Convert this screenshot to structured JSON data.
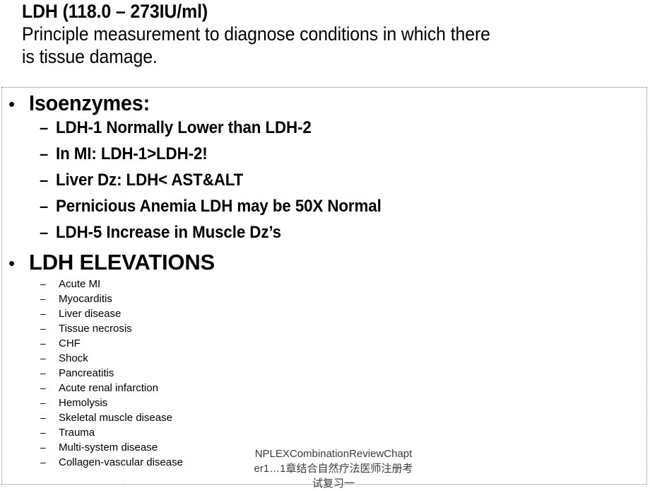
{
  "slide": {
    "title": {
      "heading": "LDH (118.0 – 273IU/ml)",
      "subline_1": "Principle measurement to diagnose conditions in which there",
      "subline_2": "is tissue damage."
    },
    "bullet_glyph": "•",
    "dash_glyph": "–",
    "sections": [
      {
        "heading": "Isoenzymes:",
        "items": [
          "LDH-1 Normally Lower than LDH-2",
          "In MI:  LDH-1>LDH-2!",
          "Liver Dz:  LDH< AST&ALT",
          "Pernicious Anemia LDH may be 50X Normal",
          "LDH-5 Increase in Muscle Dz’s"
        ]
      },
      {
        "heading": "LDH ELEVATIONS",
        "items": [
          "Acute MI",
          "Myocarditis",
          "Liver disease",
          "Tissue necrosis",
          "CHF",
          "Shock",
          "Pancreatitis",
          "Acute renal infarction",
          "Hemolysis",
          "Skeletal muscle disease",
          "Trauma",
          "Multi-system disease",
          "Collagen-vascular disease"
        ]
      }
    ],
    "watermark": {
      "line_1": "NPLEXCombinationReviewChapt",
      "line_2": "er1…1章结合自然疗法医师注册考",
      "line_3": "试复习一"
    },
    "colors": {
      "text": "#000000",
      "background": "#ffffff",
      "border": "#808080",
      "watermark_text": "#3a3a3a"
    }
  }
}
